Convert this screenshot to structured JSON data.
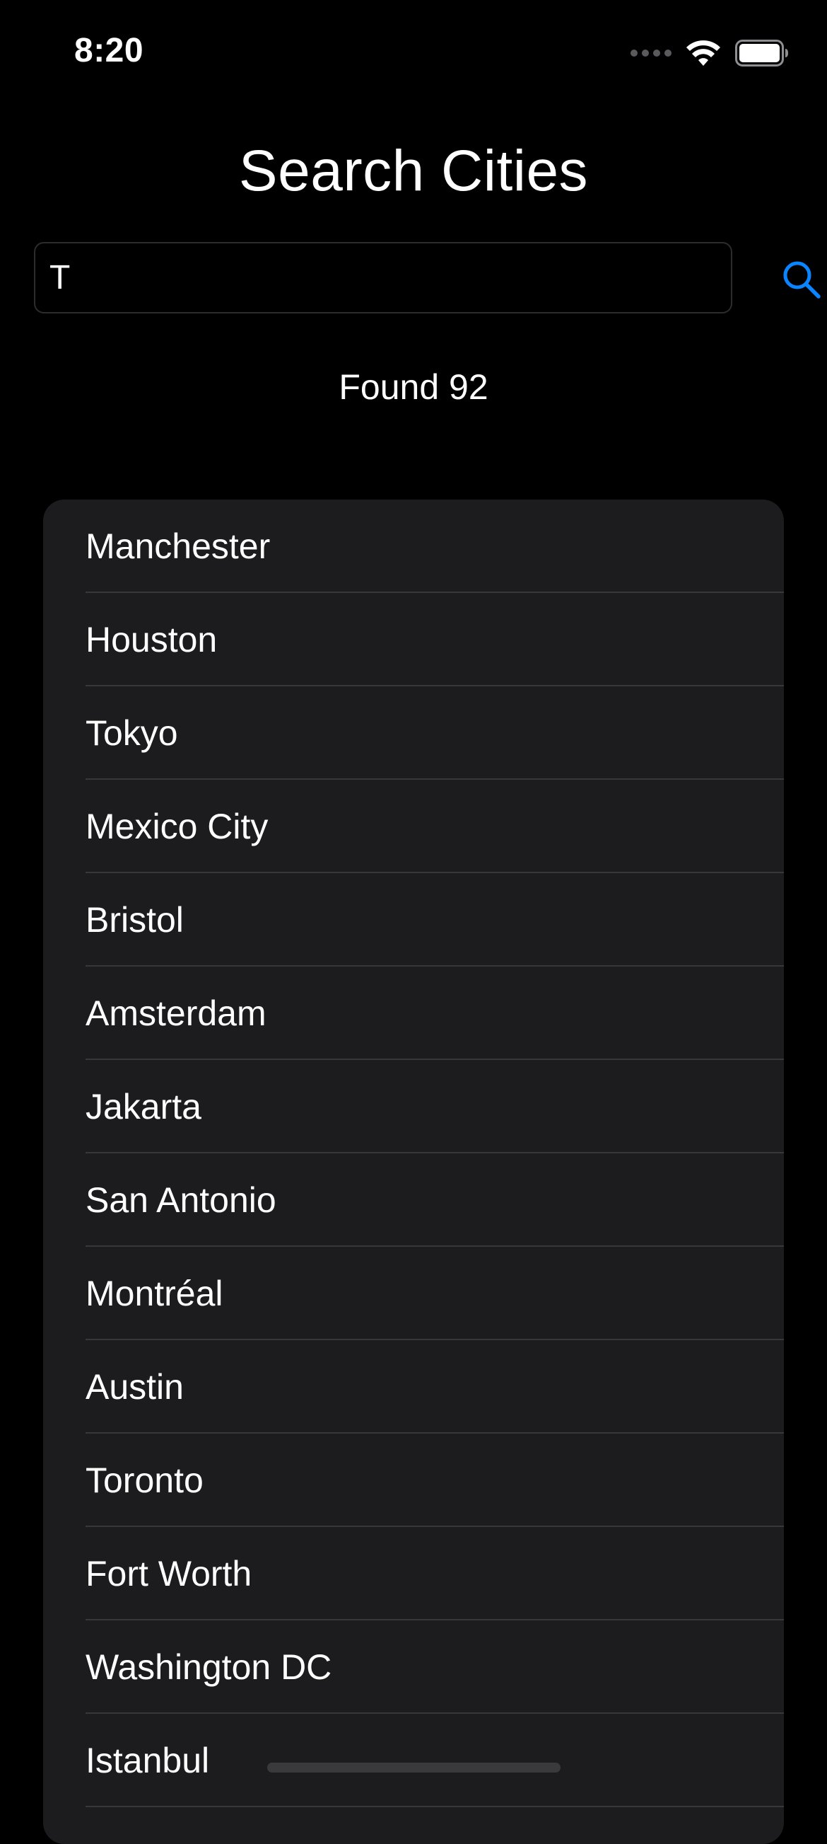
{
  "status_bar": {
    "time": "8:20",
    "icons": [
      "signal-dots-icon",
      "wifi-icon",
      "battery-icon"
    ]
  },
  "page": {
    "title": "Search Cities"
  },
  "search": {
    "value": "T",
    "placeholder": ""
  },
  "results": {
    "found_label": "Found 92"
  },
  "cities": [
    "Manchester",
    "Houston",
    "Tokyo",
    "Mexico City",
    "Bristol",
    "Amsterdam",
    "Jakarta",
    "San Antonio",
    "Montréal",
    "Austin",
    "Toronto",
    "Fort Worth",
    "Washington DC",
    "Istanbul"
  ],
  "colors": {
    "background": "#000000",
    "list_background": "#1c1c1e",
    "accent": "#0a84ff",
    "separator": "#38383a"
  }
}
